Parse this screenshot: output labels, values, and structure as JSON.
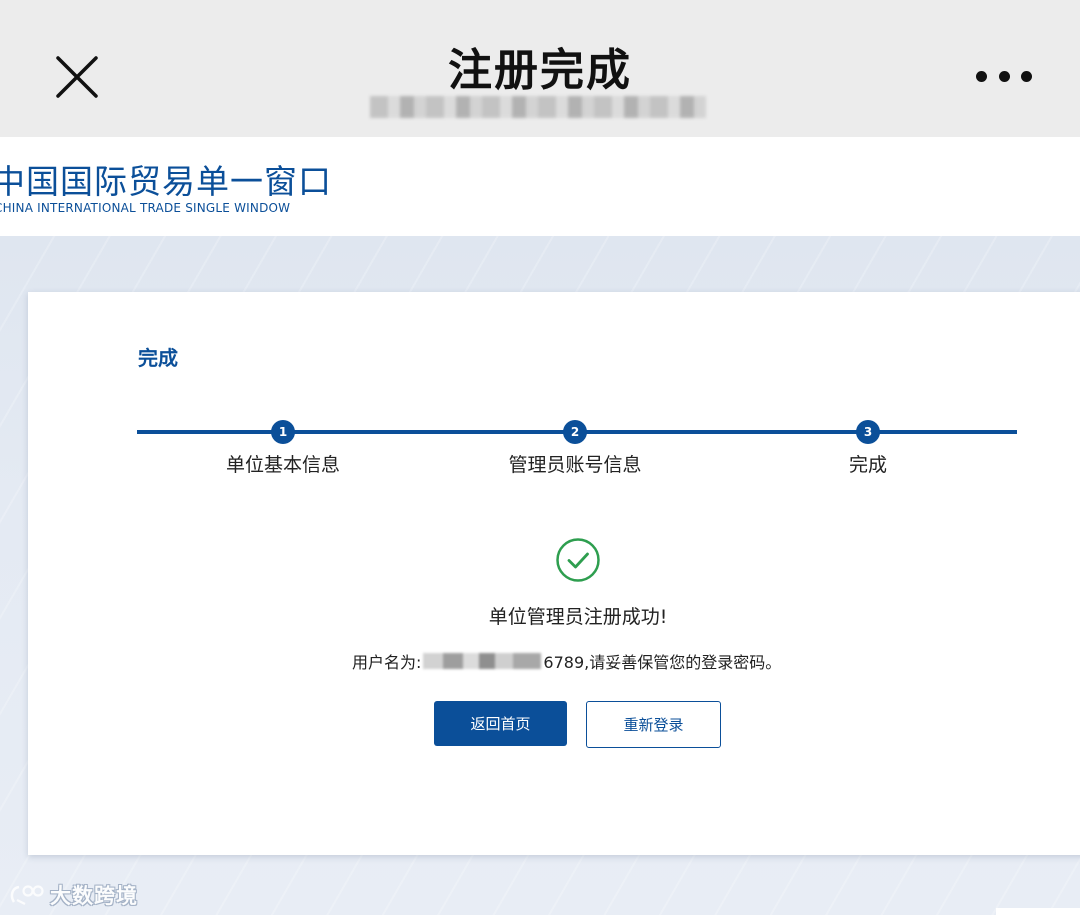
{
  "window": {
    "title": "注册完成",
    "close_icon": "close-icon",
    "more_icon": "more-dots-icon"
  },
  "site": {
    "logo_cn": "中国国际贸易单一窗口",
    "logo_en": "CHINA INTERNATIONAL TRADE SINGLE WINDOW"
  },
  "card": {
    "title": "完成",
    "steps": [
      {
        "number": "1",
        "label": "单位基本信息"
      },
      {
        "number": "2",
        "label": "管理员账号信息"
      },
      {
        "number": "3",
        "label": "完成"
      }
    ],
    "success_icon": "check-circle-icon",
    "success_message": "单位管理员注册成功!",
    "username_prefix": "用户名为:",
    "username_suffix": "6789,请妥善保管您的登录密码。",
    "buttons": {
      "home": "返回首页",
      "relogin": "重新登录"
    }
  },
  "watermark": {
    "text": "大数跨境"
  },
  "colors": {
    "primary": "#0b4f99",
    "success": "#2e9e4f",
    "header_bg": "#ececec",
    "page_bg": "#e2e8f1"
  }
}
